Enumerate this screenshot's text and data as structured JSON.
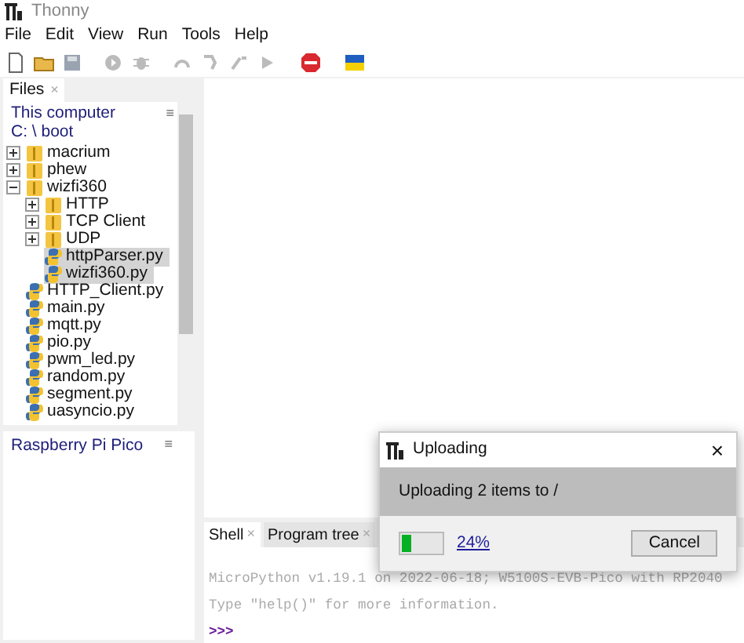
{
  "window": {
    "title": "Thonny"
  },
  "menu": [
    "File",
    "Edit",
    "View",
    "Run",
    "Tools",
    "Help"
  ],
  "files_tab": {
    "label": "Files",
    "close": "×"
  },
  "local_panel": {
    "title": "This computer",
    "path": "C: \\ boot",
    "menu": "≡",
    "tree": [
      {
        "name": "macrium",
        "kind": "folder",
        "expanded": false,
        "selected": false
      },
      {
        "name": "phew",
        "kind": "folder",
        "expanded": false,
        "selected": false
      },
      {
        "name": "wizfi360",
        "kind": "folder",
        "expanded": true,
        "selected": false,
        "children": [
          {
            "name": "HTTP",
            "kind": "folder",
            "expanded": false,
            "selected": false
          },
          {
            "name": "TCP Client",
            "kind": "folder",
            "expanded": false,
            "selected": false
          },
          {
            "name": "UDP",
            "kind": "folder",
            "expanded": false,
            "selected": false
          },
          {
            "name": "httpParser.py",
            "kind": "file",
            "selected": true
          },
          {
            "name": "wizfi360.py",
            "kind": "file",
            "selected": true
          }
        ]
      },
      {
        "name": "HTTP_Client.py",
        "kind": "file",
        "selected": false
      },
      {
        "name": "main.py",
        "kind": "file",
        "selected": false
      },
      {
        "name": "mqtt.py",
        "kind": "file",
        "selected": false
      },
      {
        "name": "pio.py",
        "kind": "file",
        "selected": false
      },
      {
        "name": "pwm_led.py",
        "kind": "file",
        "selected": false
      },
      {
        "name": "random.py",
        "kind": "file",
        "selected": false
      },
      {
        "name": "segment.py",
        "kind": "file",
        "selected": false
      },
      {
        "name": "uasyncio.py",
        "kind": "file",
        "selected": false
      }
    ]
  },
  "device_panel": {
    "title": "Raspberry Pi Pico",
    "menu": "≡"
  },
  "bottom_tabs": [
    {
      "label": "Shell",
      "close": "×",
      "selected": true
    },
    {
      "label": "Program tree",
      "close": "×",
      "selected": false
    }
  ],
  "shell": {
    "lines": [
      "MicroPython v1.19.1 on 2022-06-18; W5100S-EVB-Pico with RP2040",
      "Type \"help()\" for more information."
    ],
    "prompt": ">>>"
  },
  "dialog": {
    "title": "Uploading",
    "close": "×",
    "message": "Uploading 2 items to /",
    "progress": {
      "level": 0.24,
      "percent": "24%"
    },
    "button": "Cancel"
  }
}
